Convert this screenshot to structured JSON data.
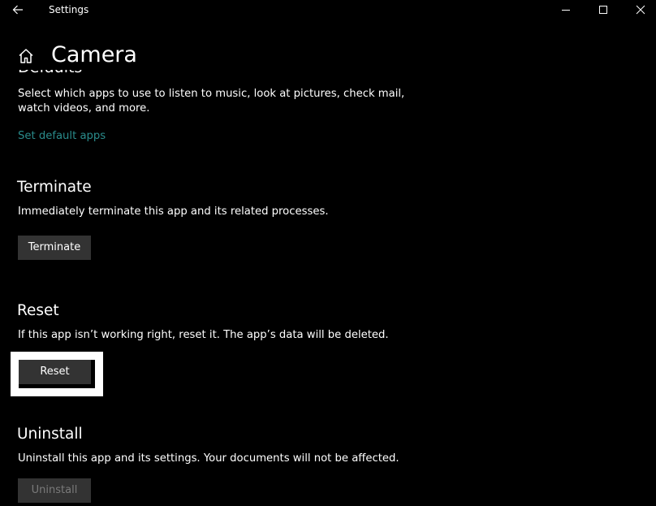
{
  "window": {
    "title": "Settings",
    "controls": {
      "back_icon": "arrow-left-icon",
      "minimize_icon": "minimize-icon",
      "maximize_icon": "maximize-icon",
      "close_icon": "close-icon"
    }
  },
  "header": {
    "home_icon": "home-icon",
    "title": "Camera"
  },
  "sections": {
    "defaults": {
      "heading_partial": "Defaults",
      "description_line1": "Select which apps to use to listen to music, look at pictures, check mail,",
      "description_line2": "watch videos, and more.",
      "link_label": "Set default apps"
    },
    "terminate": {
      "heading": "Terminate",
      "description": "Immediately terminate this app and its related processes.",
      "button_label": "Terminate"
    },
    "reset": {
      "heading": "Reset",
      "description": "If this app isn’t working right, reset it. The app’s data will be deleted.",
      "button_label": "Reset",
      "highlighted": true
    },
    "uninstall": {
      "heading": "Uninstall",
      "description": "Uninstall this app and its settings. Your documents will not be affected.",
      "button_label": "Uninstall",
      "disabled": true
    }
  },
  "colors": {
    "background": "#000000",
    "text": "#ffffff",
    "link": "#2a8c8c",
    "button_bg": "#333333",
    "disabled_text": "#7a7a7a",
    "highlight_border": "#ffffff"
  }
}
